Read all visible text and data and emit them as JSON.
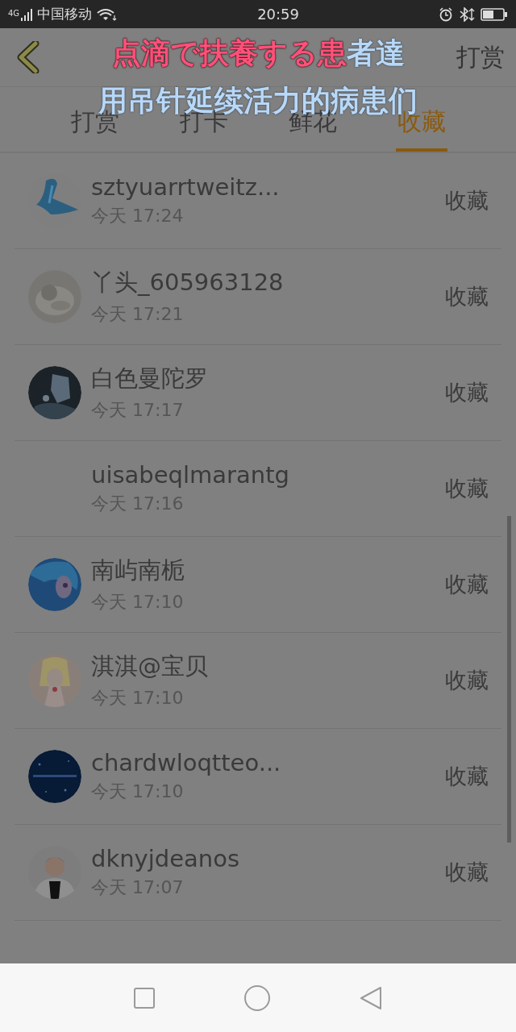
{
  "status_bar": {
    "network": "4G",
    "carrier": "中国移动",
    "time": "20:59"
  },
  "header": {
    "action": "打赏"
  },
  "subtitles": {
    "line_1": {
      "sung": "点滴で扶養する患",
      "rest": "者達"
    },
    "line_2": "用吊针延续活力的病患们"
  },
  "tabs": [
    {
      "label": "打赏",
      "selected": false
    },
    {
      "label": "打卡",
      "selected": false
    },
    {
      "label": "鲜花",
      "selected": false
    },
    {
      "label": "收藏",
      "selected": true
    }
  ],
  "list": [
    {
      "name": "sztyuarrtweitz...",
      "time": "今天 17:24",
      "action": "收藏"
    },
    {
      "name": "丫头_605963128",
      "time": "今天 17:21",
      "action": "收藏"
    },
    {
      "name": "白色曼陀罗",
      "time": "今天 17:17",
      "action": "收藏"
    },
    {
      "name": "uisabeqlmarantg",
      "time": "今天 17:16",
      "action": "收藏"
    },
    {
      "name": "南屿南栀",
      "time": "今天 17:10",
      "action": "收藏"
    },
    {
      "name": "淇淇@宝贝",
      "time": "今天 17:10",
      "action": "收藏"
    },
    {
      "name": "chardwloqtteo...",
      "time": "今天 17:10",
      "action": "收藏"
    },
    {
      "name": "dknyjdeanos",
      "time": "今天 17:07",
      "action": "收藏"
    }
  ]
}
